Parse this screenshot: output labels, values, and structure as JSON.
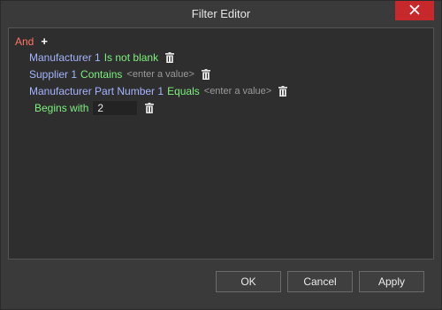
{
  "window": {
    "title": "Filter Editor",
    "close_icon": "close-icon"
  },
  "editor": {
    "root_operator": "And",
    "add_icon": "plus-icon",
    "conditions": [
      {
        "field": "Manufacturer 1",
        "operator": "Is not blank",
        "value_placeholder": ""
      },
      {
        "field": "Supplier 1",
        "operator": "Contains",
        "value_placeholder": "<enter a value>"
      },
      {
        "field": "Manufacturer Part Number 1",
        "operator": "Equals",
        "value_placeholder": "<enter a value>"
      },
      {
        "field": "",
        "operator": "Begins with",
        "value": "2"
      }
    ],
    "delete_icon": "trash-icon"
  },
  "footer": {
    "ok_label": "OK",
    "cancel_label": "Cancel",
    "apply_label": "Apply"
  },
  "colors": {
    "operator_and": "#ff7466",
    "field": "#a5b4ff",
    "condition": "#7ef07e",
    "placeholder": "#9a9a9a",
    "close_button": "#c7282b"
  }
}
